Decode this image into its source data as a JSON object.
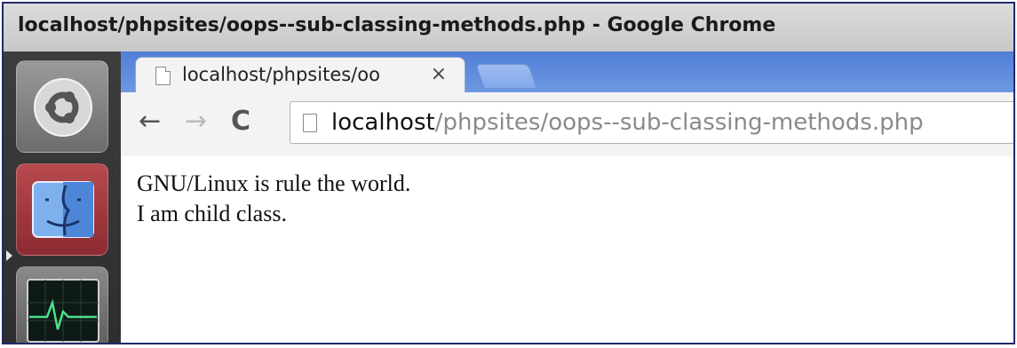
{
  "window": {
    "title": "localhost/phpsites/oops--sub-classing-methods.php - Google Chrome"
  },
  "launcher": {
    "items": [
      {
        "icon": "ubuntu-home-icon"
      },
      {
        "icon": "finder-icon"
      },
      {
        "icon": "system-monitor-icon"
      }
    ]
  },
  "browser": {
    "tab": {
      "label": "localhost/phpsites/oo",
      "close": "×"
    },
    "nav": {
      "back": "←",
      "forward": "→",
      "reload": "C"
    },
    "address": {
      "host": "localhost",
      "path": "/phpsites/oops--sub-classing-methods.php"
    }
  },
  "page": {
    "lines": [
      "GNU/Linux is rule the world.",
      "I am child class."
    ]
  },
  "colors": {
    "tabstrip": "#5b87d8",
    "launcher": "#333333",
    "frame_border": "#1f2a6b"
  }
}
